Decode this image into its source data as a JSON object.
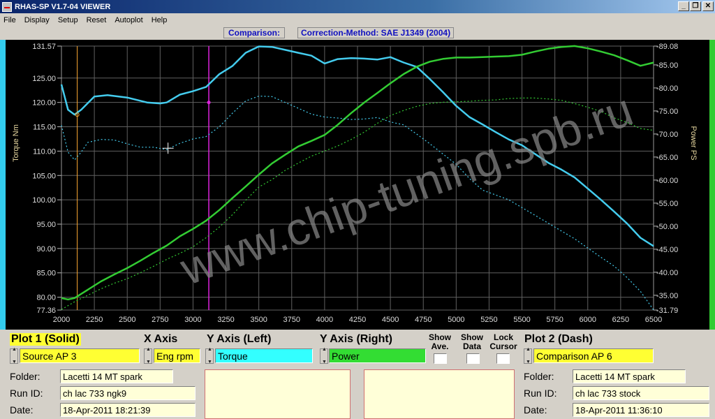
{
  "window": {
    "title": "RHAS-SP V1.7-04  VIEWER"
  },
  "menu": [
    "File",
    "Display",
    "Setup",
    "Reset",
    "Autoplot",
    "Help"
  ],
  "header": {
    "comparison_label": "Comparison:",
    "correction_label": "Correction-Method: SAE J1349 (2004)"
  },
  "watermark": "www.chip-tuning.spb.ru",
  "chart_data": {
    "type": "line",
    "xlabel": "",
    "ylabel": "Torque Nm",
    "y2label": "Power PS",
    "xlim": [
      2000,
      6500
    ],
    "ylim": [
      77.36,
      131.57
    ],
    "y2lim": [
      31.79,
      89.08
    ],
    "x_ticks": [
      "2000",
      "2250",
      "2500",
      "2750",
      "3000",
      "3250",
      "3500",
      "3750",
      "4000",
      "4250",
      "4500",
      "4750",
      "5000",
      "5250",
      "5500",
      "5750",
      "6000",
      "6250",
      "6500"
    ],
    "y_ticks": [
      "131.57",
      "125.00",
      "120.00",
      "115.00",
      "110.00",
      "105.00",
      "100.00",
      "95.00",
      "90.00",
      "85.00",
      "80.00",
      "77.36"
    ],
    "y2_ticks": [
      "89.08",
      "85.00",
      "80.00",
      "75.00",
      "70.00",
      "65.00",
      "60.00",
      "55.00",
      "50.00",
      "45.00",
      "40.00",
      "35.00",
      "31.79"
    ],
    "colors": {
      "torque": "#44ccee",
      "power": "#33cc33",
      "cursor_left": "#ffaa33",
      "cursor_right": "#dd22dd"
    },
    "cursors": [
      2120,
      3120
    ],
    "series": [
      {
        "name": "Torque",
        "axis": "left",
        "style": "solid",
        "x": [
          2000,
          2050,
          2100,
          2150,
          2250,
          2350,
          2500,
          2650,
          2750,
          2800,
          2900,
          3000,
          3100,
          3200,
          3300,
          3400,
          3500,
          3600,
          3700,
          3800,
          3900,
          4000,
          4100,
          4200,
          4300,
          4400,
          4500,
          4600,
          4700,
          4800,
          4900,
          5000,
          5100,
          5200,
          5300,
          5400,
          5500,
          5600,
          5700,
          5800,
          5900,
          6000,
          6100,
          6200,
          6300,
          6400,
          6500
        ],
        "y": [
          123.7,
          118.5,
          117.5,
          118.5,
          121.2,
          121.5,
          121.0,
          120.0,
          119.8,
          120.0,
          121.6,
          122.3,
          123.2,
          125.8,
          127.5,
          130.2,
          131.5,
          131.4,
          130.8,
          130.2,
          129.6,
          128.0,
          128.9,
          129.1,
          129.0,
          128.8,
          129.3,
          128.2,
          127.3,
          124.8,
          122.1,
          119.3,
          117.0,
          115.5,
          113.9,
          112.4,
          111.2,
          109.4,
          107.6,
          106.2,
          104.6,
          102.3,
          100.0,
          97.6,
          95.1,
          92.2,
          90.5
        ]
      },
      {
        "name": "Power",
        "axis": "right",
        "style": "solid",
        "x": [
          2000,
          2050,
          2100,
          2200,
          2300,
          2400,
          2500,
          2600,
          2700,
          2800,
          2900,
          3000,
          3100,
          3200,
          3300,
          3400,
          3500,
          3600,
          3700,
          3800,
          3900,
          4000,
          4100,
          4200,
          4300,
          4400,
          4500,
          4600,
          4700,
          4800,
          4900,
          5000,
          5100,
          5200,
          5300,
          5400,
          5500,
          5600,
          5700,
          5800,
          5900,
          6000,
          6100,
          6200,
          6300,
          6400,
          6500
        ],
        "y": [
          34.4,
          34.1,
          34.4,
          36.2,
          38.0,
          39.5,
          40.9,
          42.5,
          44.2,
          45.8,
          47.8,
          49.4,
          51.2,
          53.5,
          56.1,
          58.6,
          61.2,
          63.6,
          65.5,
          67.3,
          68.5,
          69.8,
          72.0,
          74.5,
          76.8,
          78.9,
          81.0,
          83.0,
          84.6,
          85.7,
          86.3,
          86.6,
          86.6,
          86.7,
          86.8,
          86.9,
          87.2,
          87.9,
          88.5,
          88.9,
          89.1,
          88.6,
          87.9,
          87.1,
          86.0,
          84.8,
          85.5
        ]
      },
      {
        "name": "Torque",
        "axis": "left",
        "style": "dash",
        "x": [
          2000,
          2050,
          2100,
          2150,
          2200,
          2300,
          2400,
          2500,
          2600,
          2700,
          2800,
          2900,
          3000,
          3100,
          3200,
          3300,
          3400,
          3500,
          3600,
          3700,
          3800,
          3900,
          4000,
          4100,
          4200,
          4300,
          4400,
          4500,
          4600,
          4700,
          4800,
          4900,
          5000,
          5100,
          5200,
          5300,
          5400,
          5500,
          5600,
          5700,
          5800,
          5900,
          6000,
          6100,
          6200,
          6300,
          6400,
          6500
        ],
        "y": [
          115.3,
          109.8,
          108.2,
          109.8,
          111.8,
          112.4,
          112.3,
          111.5,
          110.8,
          110.8,
          110.3,
          111.6,
          112.5,
          113.0,
          115.0,
          117.8,
          120.3,
          121.3,
          121.2,
          120.0,
          118.8,
          117.6,
          117.0,
          116.8,
          116.5,
          116.6,
          116.9,
          116.0,
          115.4,
          113.5,
          111.5,
          109.4,
          107.3,
          104.4,
          102.0,
          101.0,
          100.0,
          98.4,
          96.8,
          95.2,
          93.6,
          92.0,
          90.1,
          88.2,
          86.4,
          84.0,
          81.2,
          77.4
        ]
      },
      {
        "name": "Power",
        "axis": "right",
        "style": "dash",
        "x": [
          2000,
          2100,
          2200,
          2300,
          2400,
          2500,
          2600,
          2700,
          2800,
          2900,
          3000,
          3100,
          3200,
          3300,
          3400,
          3500,
          3600,
          3700,
          3800,
          3900,
          4000,
          4100,
          4200,
          4300,
          4400,
          4500,
          4600,
          4700,
          4800,
          4900,
          5000,
          5100,
          5200,
          5300,
          5400,
          5500,
          5600,
          5700,
          5800,
          5900,
          6000,
          6100,
          6200,
          6300,
          6400,
          6500
        ],
        "y": [
          31.9,
          33.6,
          35.0,
          36.4,
          37.6,
          38.6,
          39.9,
          41.3,
          42.8,
          44.1,
          45.5,
          47.5,
          49.8,
          52.5,
          55.6,
          58.5,
          60.1,
          62.1,
          63.7,
          65.2,
          66.3,
          67.4,
          68.8,
          70.4,
          72.3,
          74.0,
          75.1,
          76.0,
          76.6,
          76.9,
          77.0,
          77.1,
          77.3,
          77.4,
          77.7,
          77.8,
          77.8,
          77.6,
          77.3,
          76.6,
          75.8,
          74.9,
          73.5,
          72.5,
          71.2,
          70.8
        ]
      }
    ]
  },
  "controls": {
    "plot1_title": "Plot 1 (Solid)",
    "plot1_value": "Source AP 3",
    "xaxis_title": "X Axis",
    "xaxis_value": "Eng rpm",
    "yleft_title": "Y Axis (Left)",
    "yleft_value": "Torque",
    "yright_title": "Y Axis (Right)",
    "yright_value": "Power",
    "show_ave": [
      "Show",
      "Ave."
    ],
    "show_data": [
      "Show",
      "Data"
    ],
    "lock_cursor": [
      "Lock",
      "Cursor"
    ],
    "plot2_title": "Plot 2 (Dash)",
    "plot2_value": "Comparison AP 6",
    "folder_label": "Folder:",
    "runid_label": "Run ID:",
    "date_label": "Date:",
    "plot1_folder": "Lacetti 14 MT spark",
    "plot1_runid": "ch lac 733 ngk9",
    "plot1_date": "18-Apr-2011  18:21:39",
    "plot2_folder": "Lacetti 14 MT spark",
    "plot2_runid": "ch lac 733 stock",
    "plot2_date": "18-Apr-2011  11:36:10",
    "colors": {
      "highlight": "#ffff33",
      "torque_field": "#33ffff",
      "power_field": "#33dd33",
      "note_bg": "#ffffd8"
    }
  }
}
